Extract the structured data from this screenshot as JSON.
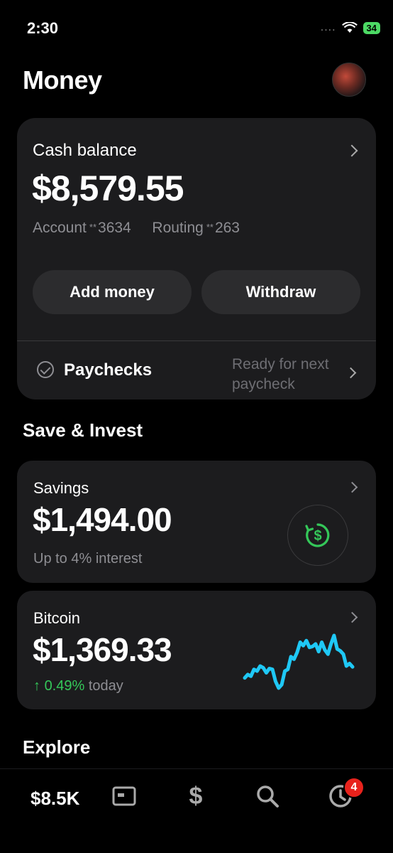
{
  "status": {
    "time": "2:30",
    "signal": "....",
    "battery": "34"
  },
  "header": {
    "title": "Money"
  },
  "cash": {
    "label": "Cash balance",
    "amount": "$8,579.55",
    "account_label": "Account",
    "account_mask": "**",
    "account_num": "3634",
    "routing_label": "Routing",
    "routing_mask": "**",
    "routing_num": "263",
    "add_money_label": "Add money",
    "withdraw_label": "Withdraw",
    "paychecks_label": "Paychecks",
    "paychecks_status": "Ready for next paycheck"
  },
  "save_invest": {
    "title": "Save & Invest"
  },
  "savings": {
    "label": "Savings",
    "amount": "$1,494.00",
    "subtitle": "Up to 4% interest",
    "icon": "dollar-cycle-icon",
    "icon_color": "#34c759"
  },
  "bitcoin": {
    "label": "Bitcoin",
    "amount": "$1,369.33",
    "change": "0.49%",
    "change_suffix": "today",
    "change_color": "#34c759",
    "spark_color": "#1fc8f5",
    "spark_values": [
      30,
      34,
      32,
      40,
      38,
      44,
      42,
      36,
      41,
      40,
      26,
      18,
      22,
      38,
      40,
      55,
      52,
      60,
      72,
      68,
      74,
      66,
      67,
      70,
      61,
      72,
      63,
      58,
      70,
      80,
      64,
      62,
      58,
      44,
      47,
      43
    ]
  },
  "explore": {
    "title": "Explore"
  },
  "tabbar": {
    "balance": "$8.5K",
    "dollar_glyph": "$",
    "activity_badge": "4",
    "icons": [
      "card-icon",
      "dollar-icon",
      "search-icon",
      "activity-clock-icon"
    ]
  }
}
